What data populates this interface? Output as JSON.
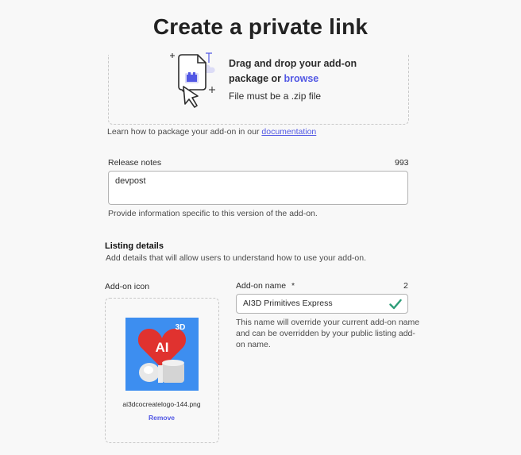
{
  "header": {
    "title": "Create a private link"
  },
  "upload": {
    "drag_text": "Drag and drop your add-on",
    "package_text": "package or ",
    "browse_label": "browse",
    "requirement": "File must be a .zip file",
    "help_prefix": "Learn how to package your add-on in our ",
    "help_link": "documentation"
  },
  "release_notes": {
    "label": "Release notes",
    "counter": "993",
    "value": "devpost",
    "description": "Provide information specific to this version of the add-on."
  },
  "listing": {
    "title": "Listing details",
    "description": "Add details that will allow users to understand how to use your add-on."
  },
  "addon_icon": {
    "label": "Add-on icon",
    "file_name": "ai3dcocreatelogo-144.png",
    "remove_label": "Remove",
    "image_text_ai": "AI",
    "image_text_3d": "3D"
  },
  "addon_name": {
    "label": "Add-on name",
    "required_marker": "*",
    "counter": "2",
    "value": "AI3D Primitives Express",
    "description_1": "This name will override your current add-on name",
    "description_2": "and can be overridden by your public listing add-",
    "description_3": "on name."
  },
  "colors": {
    "accent": "#5258e4",
    "valid": "#2d9d78",
    "icon_bg": "#3d8ef0",
    "heart": "#e0322f"
  }
}
